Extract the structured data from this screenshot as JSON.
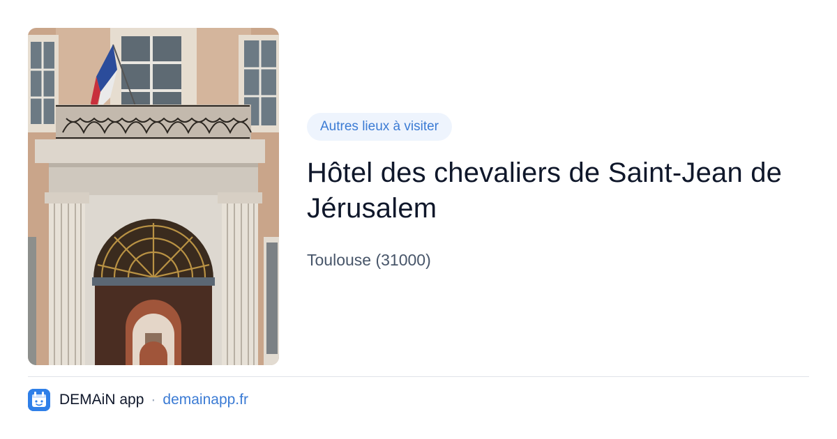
{
  "card": {
    "photo_icon": "building-photo",
    "badge": "Autres lieux à visiter",
    "title": "Hôtel des chevaliers de Saint-Jean de Jérusalem",
    "location": "Toulouse (31000)"
  },
  "footer": {
    "app_icon": "demain-app-icon",
    "app_name": "DEMAiN app",
    "separator": "·",
    "link": "demainapp.fr"
  },
  "colors": {
    "accent": "#3b7bd4",
    "badge_bg": "#eef4fd",
    "title": "#0f172a",
    "muted": "#475569",
    "app_icon_bg": "#2f7fe8"
  }
}
